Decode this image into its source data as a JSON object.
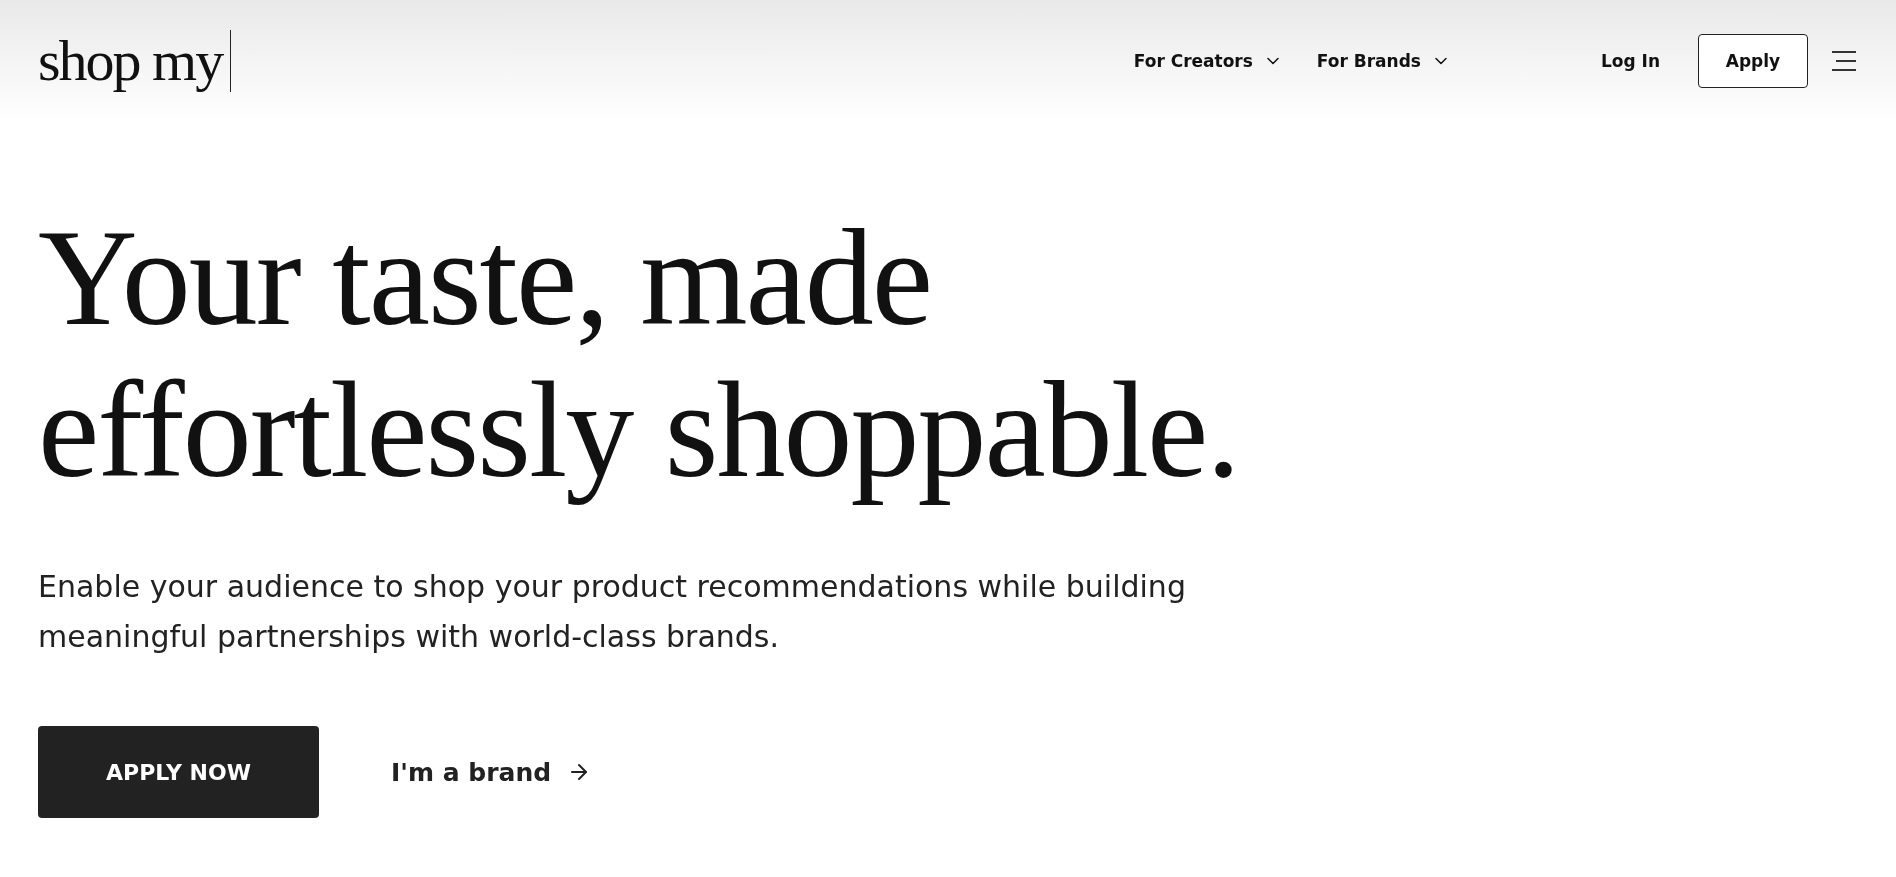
{
  "header": {
    "logo": "shop my",
    "nav": [
      {
        "label": "For Creators",
        "expanded": false
      },
      {
        "label": "For Brands",
        "expanded": false
      }
    ],
    "login": "Log In",
    "apply": "Apply"
  },
  "hero": {
    "headline": [
      "Your taste, made",
      "effortlessly shoppable."
    ],
    "subtitle": "Enable your audience to shop your product recommendations while building meaningful partnerships with world-class brands.",
    "primary": "APPLY NOW",
    "secondary": "I'm a brand"
  }
}
